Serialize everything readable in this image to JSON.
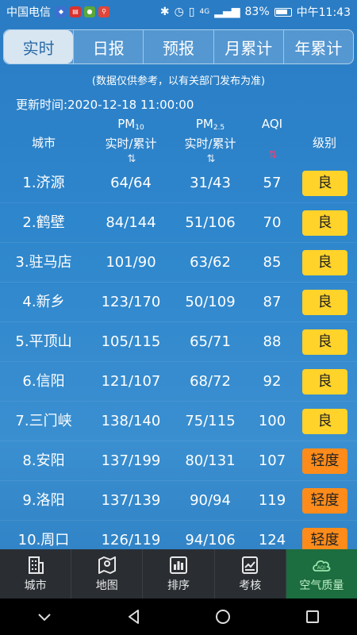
{
  "status_bar": {
    "carrier": "中国电信",
    "battery": "83%",
    "time": "中午11:43",
    "signal": "4G"
  },
  "tabs": [
    {
      "label": "实时",
      "active": true
    },
    {
      "label": "日报",
      "active": false
    },
    {
      "label": "预报",
      "active": false
    },
    {
      "label": "月累计",
      "active": false
    },
    {
      "label": "年累计",
      "active": false
    }
  ],
  "note": "(数据仅供参考，以有关部门发布为准)",
  "update_time": "更新时间:2020-12-18 11:00:00",
  "columns": {
    "city": "城市",
    "pm10_label": "PM",
    "pm10_sub": "10",
    "pm10_desc": "实时/累计",
    "pm25_label": "PM",
    "pm25_sub": "2.5",
    "pm25_desc": "实时/累计",
    "aqi": "AQI",
    "level": "级别",
    "sort_glyph": "⇅"
  },
  "rows": [
    {
      "city": "1.济源",
      "pm10": "64/64",
      "pm25": "31/43",
      "aqi": "57",
      "level": "良",
      "level_color": "#ffd32a"
    },
    {
      "city": "2.鹤壁",
      "pm10": "84/144",
      "pm25": "51/106",
      "aqi": "70",
      "level": "良",
      "level_color": "#ffd32a"
    },
    {
      "city": "3.驻马店",
      "pm10": "101/90",
      "pm25": "63/62",
      "aqi": "85",
      "level": "良",
      "level_color": "#ffd32a"
    },
    {
      "city": "4.新乡",
      "pm10": "123/170",
      "pm25": "50/109",
      "aqi": "87",
      "level": "良",
      "level_color": "#ffd32a"
    },
    {
      "city": "5.平顶山",
      "pm10": "105/115",
      "pm25": "65/71",
      "aqi": "88",
      "level": "良",
      "level_color": "#ffd32a"
    },
    {
      "city": "6.信阳",
      "pm10": "121/107",
      "pm25": "68/72",
      "aqi": "92",
      "level": "良",
      "level_color": "#ffd32a"
    },
    {
      "city": "7.三门峡",
      "pm10": "138/140",
      "pm25": "75/115",
      "aqi": "100",
      "level": "良",
      "level_color": "#ffd32a"
    },
    {
      "city": "8.安阳",
      "pm10": "137/199",
      "pm25": "80/131",
      "aqi": "107",
      "level": "轻度",
      "level_color": "#ff8c1a"
    },
    {
      "city": "9.洛阳",
      "pm10": "137/139",
      "pm25": "90/94",
      "aqi": "119",
      "level": "轻度",
      "level_color": "#ff8c1a"
    },
    {
      "city": "10.周口",
      "pm10": "126/119",
      "pm25": "94/106",
      "aqi": "124",
      "level": "轻度",
      "level_color": "#ff8c1a"
    }
  ],
  "bottom_nav": [
    {
      "label": "城市",
      "icon": "building-icon",
      "active": false
    },
    {
      "label": "地图",
      "icon": "map-icon",
      "active": false
    },
    {
      "label": "排序",
      "icon": "ranking-icon",
      "active": false
    },
    {
      "label": "考核",
      "icon": "assessment-icon",
      "active": false
    },
    {
      "label": "空气质量",
      "icon": "aqi-cloud-icon",
      "active": true
    }
  ],
  "aqi_badge_text": "AQI"
}
